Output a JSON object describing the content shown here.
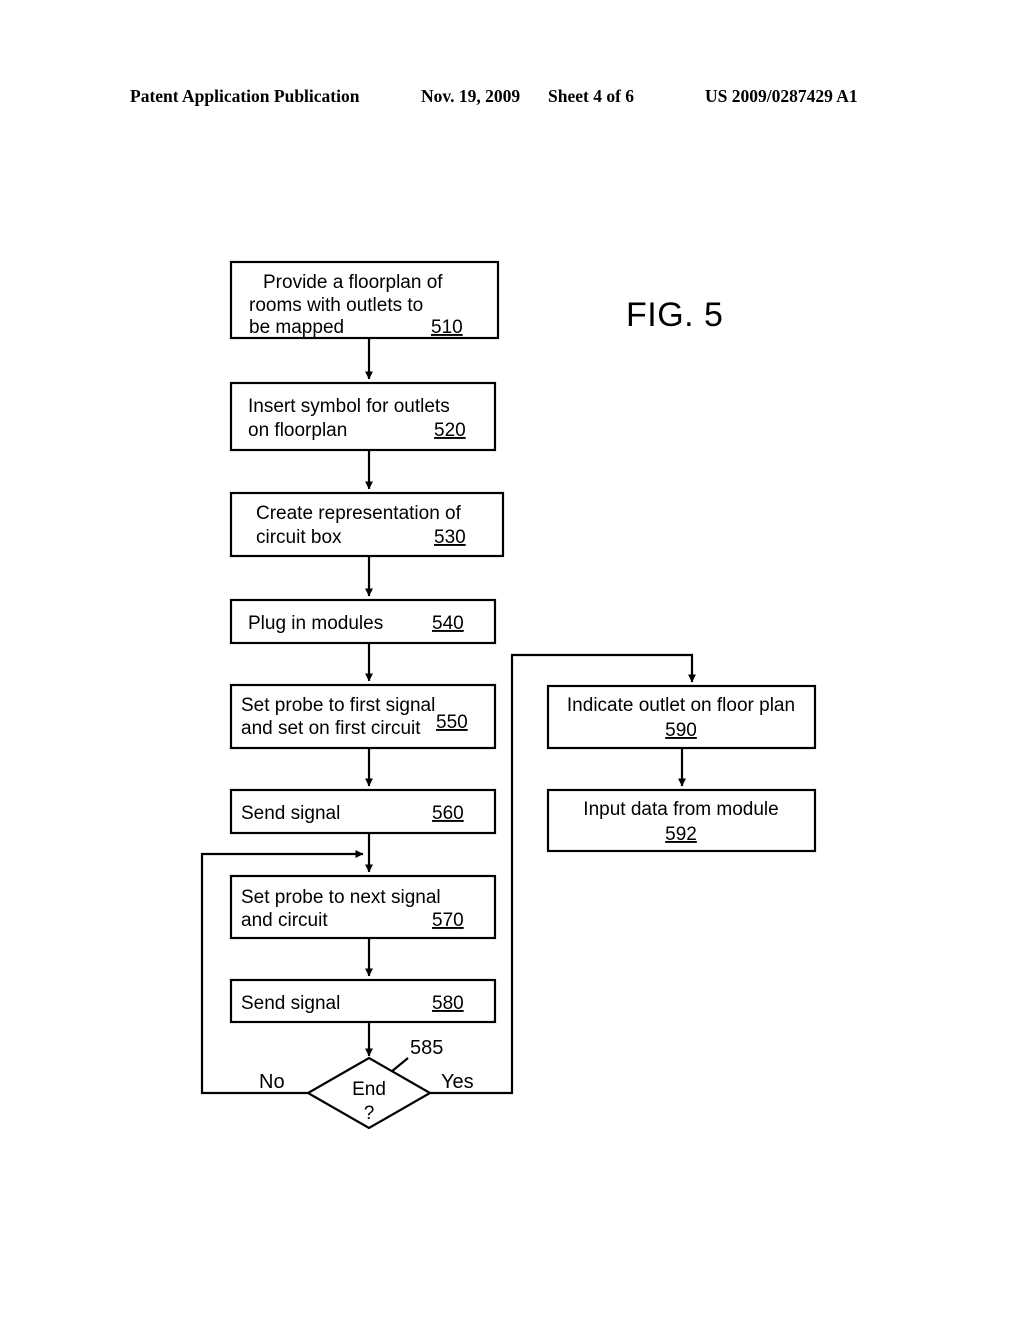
{
  "header": {
    "publication": "Patent Application Publication",
    "date": "Nov. 19, 2009",
    "sheet": "Sheet 4 of 6",
    "number": "US 2009/0287429 A1"
  },
  "figure": {
    "label": "FIG. 5"
  },
  "flowchart": {
    "nodes": [
      {
        "id": "510",
        "ref": "510",
        "lines": [
          "Provide a floorplan of",
          "rooms with outlets to",
          "be mapped"
        ],
        "shape": "rect"
      },
      {
        "id": "520",
        "ref": "520",
        "lines": [
          "Insert symbol for outlets",
          "on floorplan"
        ],
        "shape": "rect"
      },
      {
        "id": "530",
        "ref": "530",
        "lines": [
          "Create representation of",
          "circuit box"
        ],
        "shape": "rect"
      },
      {
        "id": "540",
        "ref": "540",
        "lines": [
          "Plug in modules"
        ],
        "shape": "rect"
      },
      {
        "id": "550",
        "ref": "550",
        "lines": [
          "Set probe to first signal",
          "and set on first circuit"
        ],
        "shape": "rect"
      },
      {
        "id": "560",
        "ref": "560",
        "lines": [
          "Send signal"
        ],
        "shape": "rect"
      },
      {
        "id": "570",
        "ref": "570",
        "lines": [
          "Set probe to next signal",
          "and circuit"
        ],
        "shape": "rect"
      },
      {
        "id": "580",
        "ref": "580",
        "lines": [
          "Send signal"
        ],
        "shape": "rect"
      },
      {
        "id": "585",
        "ref": "585",
        "lines": [
          "End",
          "?"
        ],
        "shape": "diamond"
      },
      {
        "id": "590",
        "ref": "590",
        "lines": [
          "Indicate outlet on floor plan"
        ],
        "shape": "rect"
      },
      {
        "id": "592",
        "ref": "592",
        "lines": [
          "Input data from module"
        ],
        "shape": "rect"
      }
    ],
    "text": {
      "n510_l1": "Provide a floorplan of",
      "n510_l2": "rooms with outlets to",
      "n510_l3": "be mapped",
      "n510_ref": "510",
      "n520_l1": "Insert symbol for outlets",
      "n520_l2": "on floorplan",
      "n520_ref": "520",
      "n530_l1": "Create representation of",
      "n530_l2": "circuit box",
      "n530_ref": "530",
      "n540_l1": "Plug in modules",
      "n540_ref": "540",
      "n550_l1": "Set probe to first signal",
      "n550_l2": "and set on first circuit",
      "n550_ref": "550",
      "n560_l1": "Send signal",
      "n560_ref": "560",
      "n570_l1": "Set probe to next signal",
      "n570_l2": "and circuit",
      "n570_ref": "570",
      "n580_l1": "Send signal",
      "n580_ref": "580",
      "n585_l1": "End",
      "n585_l2": "?",
      "n585_ref": "585",
      "n590_l1": "Indicate outlet on floor plan",
      "n590_ref": "590",
      "n592_l1": "Input data from module",
      "n592_ref": "592"
    },
    "branches": {
      "no_label": "No",
      "yes_label": "Yes"
    },
    "colors": {
      "stroke": "#000000",
      "fill": "#ffffff",
      "text": "#000000"
    }
  }
}
